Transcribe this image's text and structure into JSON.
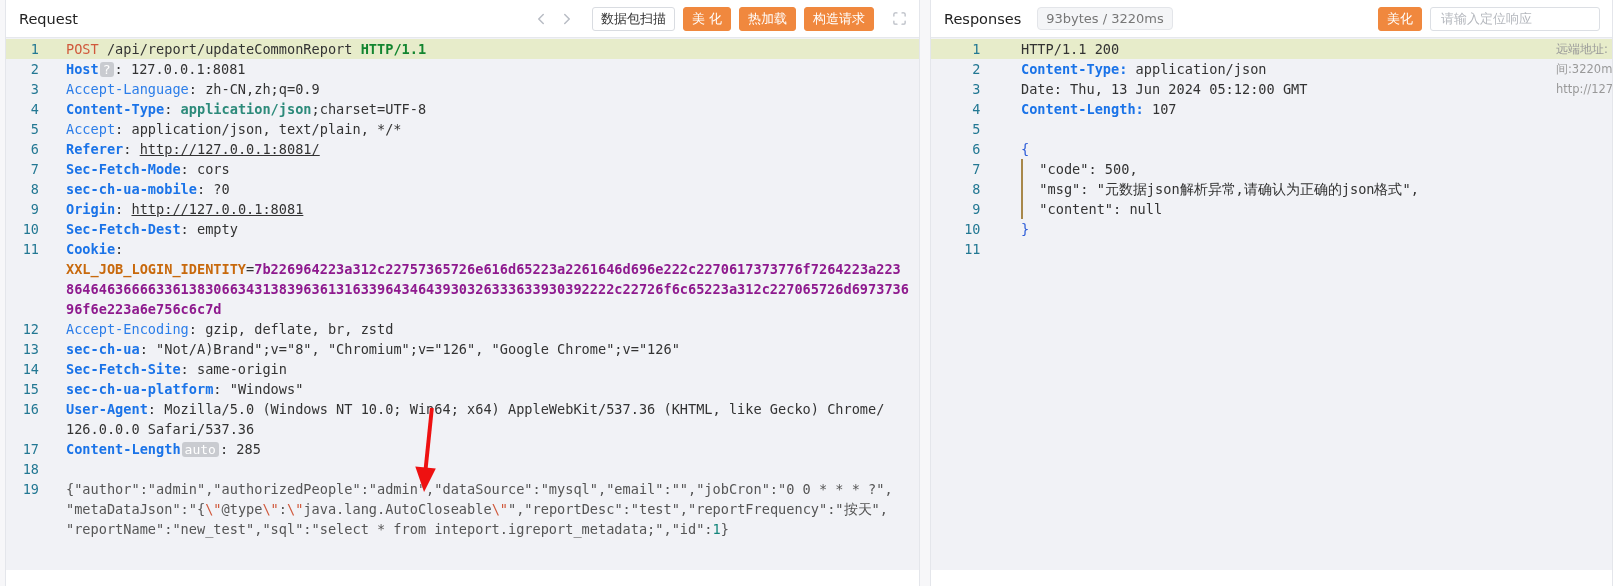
{
  "request": {
    "title": "Request",
    "tools": [
      {
        "kind": "outline",
        "label": "数据包扫描"
      },
      {
        "kind": "primary",
        "label": "美 化"
      },
      {
        "kind": "primary",
        "label": "热加载"
      },
      {
        "kind": "primary",
        "label": "构造请求"
      }
    ],
    "lines": [
      {
        "number": "1",
        "highlighted": true,
        "segments": [
          {
            "kind": "method",
            "text": "POST"
          },
          {
            "kind": "text",
            "text": " /api/report/updateCommonReport "
          },
          {
            "kind": "proto",
            "text": "HTTP/1.1"
          }
        ]
      },
      {
        "number": "2",
        "highlighted": false,
        "segments": [
          {
            "kind": "key",
            "text": "Host"
          },
          {
            "kind": "badge",
            "text": "?"
          },
          {
            "kind": "text",
            "text": ": 127.0.0.1:8081"
          }
        ]
      },
      {
        "number": "3",
        "highlighted": false,
        "segments": [
          {
            "kind": "key-light",
            "text": "Accept-Language"
          },
          {
            "kind": "text",
            "text": ": zh-CN,zh;q=0.9"
          }
        ]
      },
      {
        "number": "4",
        "highlighted": false,
        "segments": [
          {
            "kind": "key",
            "text": "Content-Type"
          },
          {
            "kind": "text",
            "text": ": "
          },
          {
            "kind": "ctype",
            "text": "application/json"
          },
          {
            "kind": "text",
            "text": ";charset=UTF-8"
          }
        ]
      },
      {
        "number": "5",
        "highlighted": false,
        "segments": [
          {
            "kind": "key-light",
            "text": "Accept"
          },
          {
            "kind": "text",
            "text": ": application/json, text/plain, */*"
          }
        ]
      },
      {
        "number": "6",
        "highlighted": false,
        "segments": [
          {
            "kind": "key",
            "text": "Referer"
          },
          {
            "kind": "text",
            "text": ": "
          },
          {
            "kind": "link",
            "text": "http://127.0.0.1:8081/"
          }
        ]
      },
      {
        "number": "7",
        "highlighted": false,
        "segments": [
          {
            "kind": "key",
            "text": "Sec-Fetch-Mode"
          },
          {
            "kind": "text",
            "text": ": cors"
          }
        ]
      },
      {
        "number": "8",
        "highlighted": false,
        "segments": [
          {
            "kind": "key",
            "text": "sec-ch-ua-mobile"
          },
          {
            "kind": "text",
            "text": ": ?0"
          }
        ]
      },
      {
        "number": "9",
        "highlighted": false,
        "segments": [
          {
            "kind": "key",
            "text": "Origin"
          },
          {
            "kind": "text",
            "text": ": "
          },
          {
            "kind": "link",
            "text": "http://127.0.0.1:8081"
          }
        ]
      },
      {
        "number": "10",
        "highlighted": false,
        "segments": [
          {
            "kind": "key",
            "text": "Sec-Fetch-Dest"
          },
          {
            "kind": "text",
            "text": ": empty"
          }
        ]
      },
      {
        "number": "11",
        "highlighted": false,
        "segments": [
          {
            "kind": "key",
            "text": "Cookie"
          },
          {
            "kind": "text",
            "text": ": "
          },
          {
            "kind": "cookie-name",
            "text": "XXL_JOB_LOGIN_IDENTITY",
            "new_row": true
          },
          {
            "kind": "text",
            "text": "="
          },
          {
            "kind": "cookie-value",
            "text": "7b226964223a312c22757365726e616d65223a2261646d696e222c2270617373776f7264223a223"
          },
          {
            "kind": "cookie-value",
            "text": "8646463666633613830663431383963613163396434643930326333633930392222c22726f6c65223a312c227065726d6973736",
            "new_row": true
          },
          {
            "kind": "cookie-value",
            "text": "96f6e223a6e756c6c7d",
            "new_row": true
          }
        ]
      },
      {
        "number": "12",
        "highlighted": false,
        "segments": [
          {
            "kind": "key-light",
            "text": "Accept-Encoding"
          },
          {
            "kind": "text",
            "text": ": gzip, deflate, br, zstd"
          }
        ]
      },
      {
        "number": "13",
        "highlighted": false,
        "segments": [
          {
            "kind": "key",
            "text": "sec-ch-ua"
          },
          {
            "kind": "text",
            "text": ": \"Not/A)Brand\";v=\"8\", \"Chromium\";v=\"126\", \"Google Chrome\";v=\"126\""
          }
        ]
      },
      {
        "number": "14",
        "highlighted": false,
        "segments": [
          {
            "kind": "key",
            "text": "Sec-Fetch-Site"
          },
          {
            "kind": "text",
            "text": ": same-origin"
          }
        ]
      },
      {
        "number": "15",
        "highlighted": false,
        "segments": [
          {
            "kind": "key",
            "text": "sec-ch-ua-platform"
          },
          {
            "kind": "text",
            "text": ": \"Windows\""
          }
        ]
      },
      {
        "number": "16",
        "highlighted": false,
        "segments": [
          {
            "kind": "key",
            "text": "User-Agent"
          },
          {
            "kind": "text",
            "text": ": Mozilla/5.0 (Windows NT 10.0; Win64; x64) AppleWebKit/537.36 (KHTML, like Gecko) Chrome/"
          },
          {
            "kind": "text",
            "text": "126.0.0.0 Safari/537.36",
            "new_row": true
          }
        ]
      },
      {
        "number": "17",
        "highlighted": false,
        "segments": [
          {
            "kind": "key",
            "text": "Content-Length"
          },
          {
            "kind": "badge",
            "text": "auto"
          },
          {
            "kind": "text",
            "text": ": 285"
          }
        ]
      },
      {
        "number": "18",
        "highlighted": false
      },
      {
        "number": "19",
        "highlighted": false,
        "segments": [
          {
            "kind": "body",
            "text": "{\"author\":\"admin\",\"authorizedPeople\":\"admin\",\"dataSource\":\"mysql\",\"email\":\"\",\"jobCron\":\"0 0 * * * ?\","
          },
          {
            "kind": "body",
            "text": "\"metaDataJson\":\"{",
            "new_row": true
          },
          {
            "kind": "escape",
            "text": "\\\""
          },
          {
            "kind": "body",
            "text": "@type"
          },
          {
            "kind": "escape",
            "text": "\\\""
          },
          {
            "kind": "body",
            "text": ":"
          },
          {
            "kind": "escape",
            "text": "\\\""
          },
          {
            "kind": "body",
            "text": "java.lang.AutoCloseable"
          },
          {
            "kind": "escape",
            "text": "\\\""
          },
          {
            "kind": "body",
            "text": "\",\"reportDesc\":\"test\",\"reportFrequency\":\"按天\","
          },
          {
            "kind": "body",
            "text": "\"reportName\":\"new_test\",\"sql\":\"select * from inteport.igreport_metadata;\",\"id\":",
            "new_row": true
          },
          {
            "kind": "number",
            "text": "1"
          },
          {
            "kind": "body",
            "text": "}"
          }
        ]
      }
    ]
  },
  "response": {
    "title": "Responses",
    "stats": "93bytes / 3220ms",
    "beautify": "美化",
    "search": {
      "placeholder": "请输入定位响应"
    },
    "side_notes": [
      "远端地址:",
      "间:3220m",
      "http://127"
    ],
    "lines": [
      {
        "number": "1",
        "highlighted": true,
        "segments": [
          {
            "kind": "text",
            "text": "HTTP/1.1 200"
          }
        ]
      },
      {
        "number": "2",
        "highlighted": false,
        "segments": [
          {
            "kind": "key",
            "text": "Content-Type:"
          },
          {
            "kind": "text",
            "text": " application/json"
          }
        ]
      },
      {
        "number": "3",
        "highlighted": false,
        "segments": [
          {
            "kind": "text",
            "text": "Date: Thu, 13 Jun 2024 05:12:00 GMT"
          }
        ]
      },
      {
        "number": "4",
        "highlighted": false,
        "segments": [
          {
            "kind": "key",
            "text": "Content-Length:"
          },
          {
            "kind": "text",
            "text": " 107"
          }
        ]
      },
      {
        "number": "5",
        "highlighted": false
      },
      {
        "number": "6",
        "highlighted": false,
        "segments": [
          {
            "kind": "brace",
            "text": "{"
          }
        ]
      },
      {
        "number": "7",
        "highlighted": false,
        "indent_guide": true,
        "segments": [
          {
            "kind": "text",
            "text": "  \"code\": 500,"
          }
        ]
      },
      {
        "number": "8",
        "highlighted": false,
        "indent_guide": true,
        "segments": [
          {
            "kind": "text",
            "text": "  \"msg\": \"元数据json解析异常,请确认为正确的json格式\","
          }
        ]
      },
      {
        "number": "9",
        "highlighted": false,
        "indent_guide": true,
        "segments": [
          {
            "kind": "text",
            "text": "  \"content\": null"
          }
        ]
      },
      {
        "number": "10",
        "highlighted": false,
        "segments": [
          {
            "kind": "brace",
            "text": "}"
          }
        ]
      },
      {
        "number": "11",
        "highlighted": false
      }
    ]
  }
}
